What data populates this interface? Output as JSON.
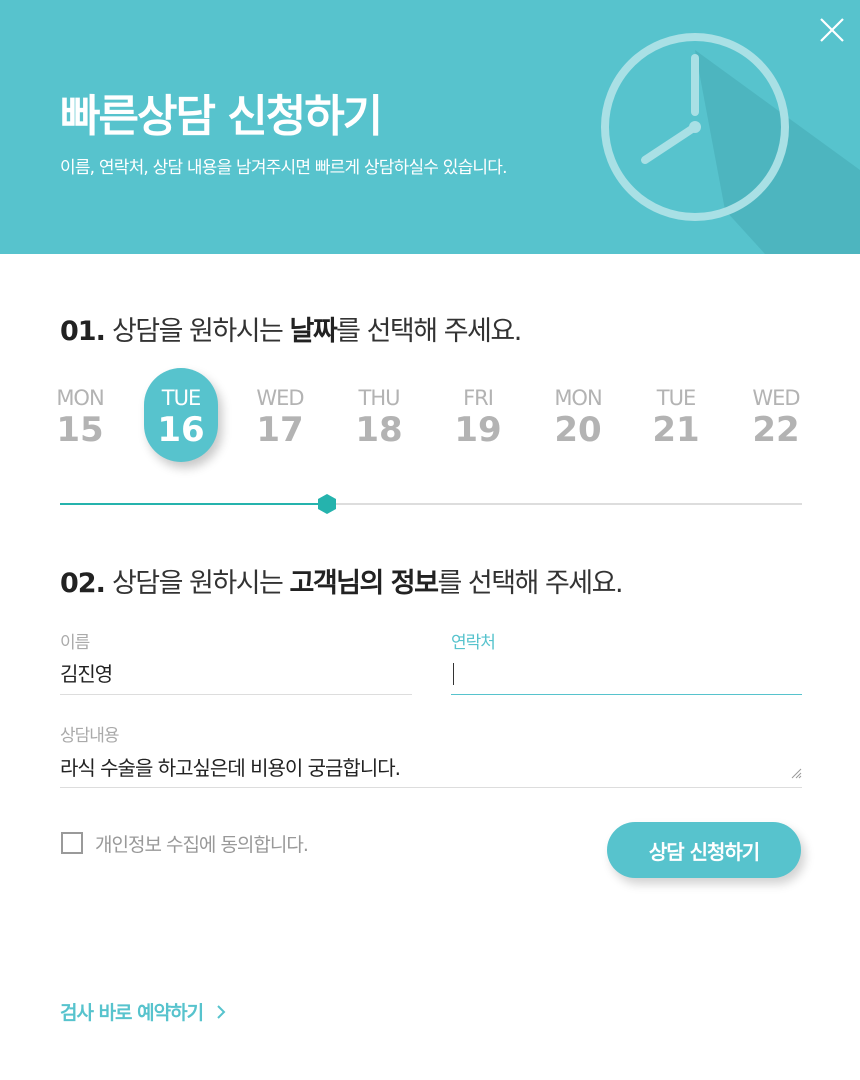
{
  "header": {
    "title": "빠른상담 신청하기",
    "subtitle": "이름, 연락처, 상담 내용을 남겨주시면 빠르게 상담하실수 있습니다.",
    "background_color": "#57c3cd",
    "close_icon": "close-icon",
    "decor_icon": "clock-icon"
  },
  "step1": {
    "number": "01.",
    "prefix": "상담을 원하시는 ",
    "highlight": "날짜",
    "suffix": "를 선택해 주세요."
  },
  "days": [
    {
      "dow": "MON",
      "date": "15"
    },
    {
      "dow": "TUE",
      "date": "16"
    },
    {
      "dow": "WED",
      "date": "17"
    },
    {
      "dow": "THU",
      "date": "18"
    },
    {
      "dow": "FRI",
      "date": "19"
    },
    {
      "dow": "MON",
      "date": "20"
    },
    {
      "dow": "TUE",
      "date": "21"
    },
    {
      "dow": "WED",
      "date": "22"
    }
  ],
  "selected_day_index": 1,
  "slider_value": 0.36,
  "step2": {
    "number": "02.",
    "prefix": "상담을 원하시는 ",
    "highlight": "고객님의 정보",
    "suffix": "를 선택해 주세요."
  },
  "form": {
    "name_label": "이름",
    "name_value": "김진영",
    "phone_label": "연락처",
    "phone_value": "",
    "content_label": "상담내용",
    "content_value": "라식 수술을 하고싶은데 비용이 궁금합니다.",
    "agree_label": "개인정보 수집에 동의합니다.",
    "agree_checked": false,
    "submit_label": "상담 신청하기"
  },
  "footer": {
    "link_label": "검사 바로 예약하기",
    "link_icon": "chevron-right-icon"
  },
  "colors": {
    "accent": "#57c3cd",
    "muted_text": "#b3b3b3"
  }
}
